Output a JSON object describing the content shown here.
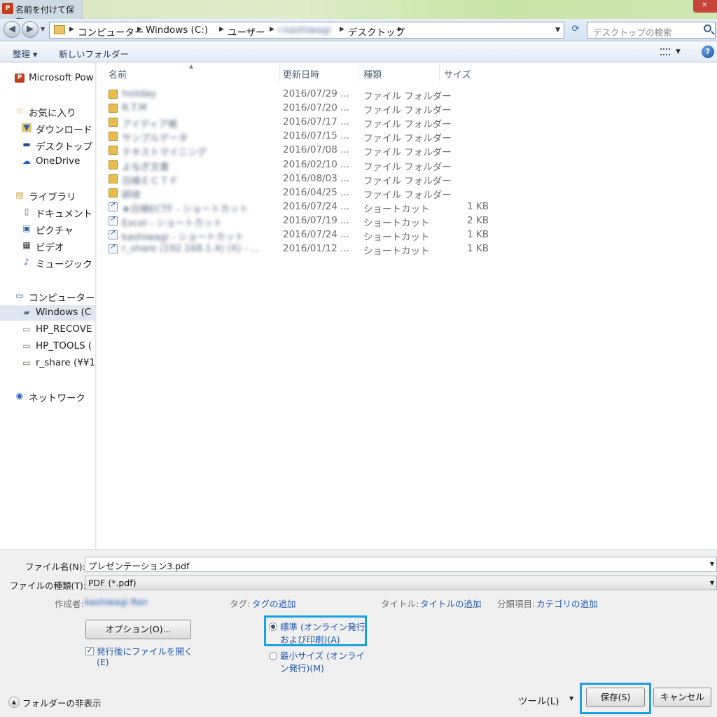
{
  "window": {
    "title": "名前を付けて保存",
    "app_badge": "P"
  },
  "address": {
    "crumbs": [
      "コンピューター",
      "Windows (C:)",
      "ユーザー",
      "r.kashiwagi",
      "デスクトップ"
    ],
    "search_placeholder": "デスクトップの検索"
  },
  "toolbar": {
    "organize": "整理 ▾",
    "new_folder": "新しいフォルダー",
    "help": "?"
  },
  "nav": {
    "items": [
      {
        "label": "Microsoft Pow",
        "icon": "powerpoint-icon",
        "glyph": "P"
      },
      {
        "label": "お気に入り",
        "icon": "star-icon",
        "glyph": "☆"
      },
      {
        "label": "ダウンロード",
        "icon": "download-folder-icon",
        "glyph": "▼"
      },
      {
        "label": "デスクトップ",
        "icon": "desktop-icon",
        "glyph": "▬"
      },
      {
        "label": "OneDrive",
        "icon": "cloud-icon",
        "glyph": "☁"
      },
      {
        "label": "ライブラリ",
        "icon": "library-icon",
        "glyph": "▤"
      },
      {
        "label": "ドキュメント",
        "icon": "document-icon",
        "glyph": "▯"
      },
      {
        "label": "ピクチャ",
        "icon": "picture-icon",
        "glyph": "▣"
      },
      {
        "label": "ビデオ",
        "icon": "video-icon",
        "glyph": "▦"
      },
      {
        "label": "ミュージック",
        "icon": "music-icon",
        "glyph": "♪"
      },
      {
        "label": "コンピューター",
        "icon": "computer-icon",
        "glyph": "▭"
      },
      {
        "label": "Windows (C",
        "icon": "drive-icon",
        "glyph": "▰"
      },
      {
        "label": "HP_RECOVE",
        "icon": "drive-icon",
        "glyph": "▭"
      },
      {
        "label": "HP_TOOLS (",
        "icon": "drive-icon",
        "glyph": "▭"
      },
      {
        "label": "r_share (¥¥1",
        "icon": "network-drive-icon",
        "glyph": "▭"
      },
      {
        "label": "ネットワーク",
        "icon": "network-icon",
        "glyph": "◉"
      }
    ]
  },
  "columns": {
    "name": "名前",
    "modified": "更新日時",
    "type": "種類",
    "size": "サイズ"
  },
  "files": [
    {
      "name": "holiday",
      "date": "2016/07/29 ...",
      "type": "ファイル フォルダー",
      "size": "",
      "kind": "folder"
    },
    {
      "name": "R.T.M",
      "date": "2016/07/20 ...",
      "type": "ファイル フォルダー",
      "size": "",
      "kind": "folder"
    },
    {
      "name": "アイディア帳",
      "date": "2016/07/17 ...",
      "type": "ファイル フォルダー",
      "size": "",
      "kind": "folder"
    },
    {
      "name": "サンプルデータ",
      "date": "2016/07/15 ...",
      "type": "ファイル フォルダー",
      "size": "",
      "kind": "folder"
    },
    {
      "name": "テキストマイニング",
      "date": "2016/07/08 ...",
      "type": "ファイル フォルダー",
      "size": "",
      "kind": "folder"
    },
    {
      "name": "よなぎ文書",
      "date": "2016/02/10 ...",
      "type": "ファイル フォルダー",
      "size": "",
      "kind": "folder"
    },
    {
      "name": "日検ＥＣＴＦ",
      "date": "2016/08/03 ...",
      "type": "ファイル フォルダー",
      "size": "",
      "kind": "folder"
    },
    {
      "name": "研修",
      "date": "2016/04/25 ...",
      "type": "ファイル フォルダー",
      "size": "",
      "kind": "folder"
    },
    {
      "name": "★日検ECTF - ショートカット",
      "date": "2016/07/24 ...",
      "type": "ショートカット",
      "size": "1 KB",
      "kind": "shortcut"
    },
    {
      "name": "Excel - ショートカット",
      "date": "2016/07/19 ...",
      "type": "ショートカット",
      "size": "2 KB",
      "kind": "shortcut"
    },
    {
      "name": "kashiwagi - ショートカット",
      "date": "2016/07/24 ...",
      "type": "ショートカット",
      "size": "1 KB",
      "kind": "shortcut"
    },
    {
      "name": "r_share (192.168.1.4) (X) - ...",
      "date": "2016/01/12 ...",
      "type": "ショートカット",
      "size": "1 KB",
      "kind": "shortcut"
    }
  ],
  "form": {
    "filename_label": "ファイル名(N):",
    "filename_value": "プレゼンテーション3.pdf",
    "filetype_label": "ファイルの種類(T):",
    "filetype_value": "PDF (*.pdf)",
    "author_label": "作成者:",
    "author_value": "kashiwagi Ron",
    "tags_label": "タグ:",
    "tags_value": "タグの追加",
    "title_label": "タイトル:",
    "title_value": "タイトルの追加",
    "category_label": "分類項目:",
    "category_value": "カテゴリの追加",
    "options_button": "オプション(O)...",
    "open_after_line1": "発行後にファイルを開く",
    "open_after_line2": "(E)",
    "radio_standard_line1": "標準 (オンライン発行",
    "radio_standard_line2": "および印刷)(A)",
    "radio_min_line1": "最小サイズ (オンライ",
    "radio_min_line2": "ン発行)(M)",
    "hide_folders": "フォルダーの非表示",
    "tools": "ツール(L)",
    "save": "保存(S)",
    "cancel": "キャンセル"
  },
  "colors": {
    "highlight": "#1aa1e4",
    "link": "#1d56b3"
  }
}
